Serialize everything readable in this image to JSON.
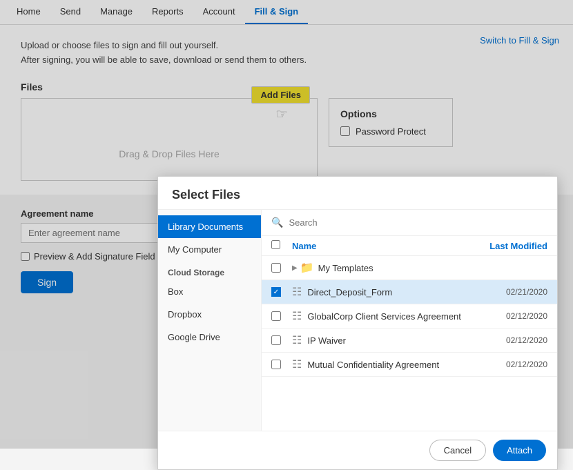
{
  "nav": {
    "items": [
      {
        "label": "Home",
        "id": "home",
        "active": false
      },
      {
        "label": "Send",
        "id": "send",
        "active": false
      },
      {
        "label": "Manage",
        "id": "manage",
        "active": false
      },
      {
        "label": "Reports",
        "id": "reports",
        "active": false
      },
      {
        "label": "Account",
        "id": "account",
        "active": false
      },
      {
        "label": "Fill & Sign",
        "id": "fill-sign",
        "active": true
      }
    ]
  },
  "header": {
    "switch_link": "Switch to Fill & Sign"
  },
  "description": {
    "line1": "Upload or choose files to sign and fill out yourself.",
    "line2": "After signing, you will be able to save, download or send them to others."
  },
  "files_section": {
    "label": "Files",
    "add_files_btn": "Add Files",
    "drag_drop_text": "Drag & Drop Files Here"
  },
  "options": {
    "title": "Options",
    "password_protect": "Password Protect"
  },
  "form": {
    "agreement_label": "Agreement name",
    "agreement_placeholder": "Enter agreement name",
    "preview_label": "Preview & Add Signature Field",
    "sign_btn": "Sign"
  },
  "modal": {
    "title": "Select Files",
    "search_placeholder": "Search",
    "sidebar": {
      "library_documents": "Library Documents",
      "my_computer": "My Computer",
      "cloud_storage_label": "Cloud Storage",
      "box": "Box",
      "dropbox": "Dropbox",
      "google_drive": "Google Drive"
    },
    "table": {
      "col_name": "Name",
      "col_last_modified": "Last Modified"
    },
    "folders": [
      {
        "name": "My Templates",
        "type": "folder"
      }
    ],
    "files": [
      {
        "name": "Direct_Deposit_Form",
        "date": "02/21/2020",
        "selected": true
      },
      {
        "name": "GlobalCorp Client Services Agreement",
        "date": "02/12/2020",
        "selected": false
      },
      {
        "name": "IP Waiver",
        "date": "02/12/2020",
        "selected": false
      },
      {
        "name": "Mutual Confidentiality Agreement",
        "date": "02/12/2020",
        "selected": false
      }
    ],
    "cancel_btn": "Cancel",
    "attach_btn": "Attach"
  }
}
